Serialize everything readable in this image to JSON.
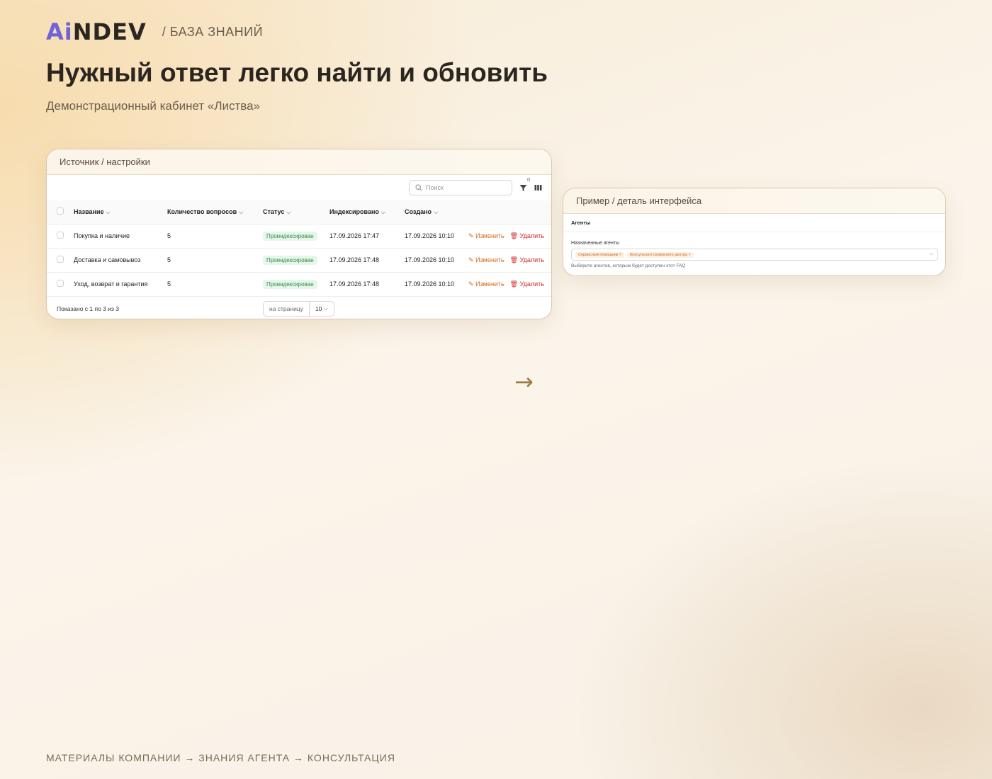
{
  "brand": {
    "logo_ai": "Ai",
    "logo_rest": "NDEV",
    "section": "/ БАЗА ЗНАНИЙ"
  },
  "title": "Нужный ответ легко найти и обновить",
  "subtitle": "Демонстрационный кабинет «Листва»",
  "source_card": {
    "header": "Источник / настройки",
    "search_placeholder": "Поиск",
    "filter_count": "0",
    "columns": [
      "Название",
      "Количество вопросов",
      "Статус",
      "Индексировано",
      "Создано"
    ],
    "rows": [
      {
        "name": "Покупка и наличие",
        "count": "5",
        "status": "Проиндексирован",
        "indexed": "17.09.2026 17:47",
        "created": "17.09.2026 10:10"
      },
      {
        "name": "Доставка и самовывоз",
        "count": "5",
        "status": "Проиндексирован",
        "indexed": "17.09.2026 17:48",
        "created": "17.09.2026 10:10"
      },
      {
        "name": "Уход, возврат и гарантия",
        "count": "5",
        "status": "Проиндексирован",
        "indexed": "17.09.2026 17:48",
        "created": "17.09.2026 10:10"
      }
    ],
    "edit_label": "Изменить",
    "delete_label": "Удалить",
    "shown_text": "Показано с 1 по 3 из 3",
    "per_page_label": "на страницу",
    "per_page_value": "10"
  },
  "detail_card": {
    "header": "Пример / деталь интерфейса",
    "section": "Агенты",
    "field_label": "Назначенные агенты",
    "chips": [
      "Сервисный помощник",
      "Консультант сервисного центра"
    ],
    "hint": "Выберите агентов, которым будет доступен этот FAQ"
  },
  "arrow": "→",
  "flow": "МАТЕРИАЛЫ КОМПАНИИ → ЗНАНИЯ АГЕНТА → КОНСУЛЬТАЦИЯ",
  "colors": {
    "accent_logo": "#6f63d8",
    "edit": "#d06a1c",
    "delete": "#d42a2a",
    "status_bg": "#e6f6ea",
    "status_text": "#2f8a46"
  }
}
